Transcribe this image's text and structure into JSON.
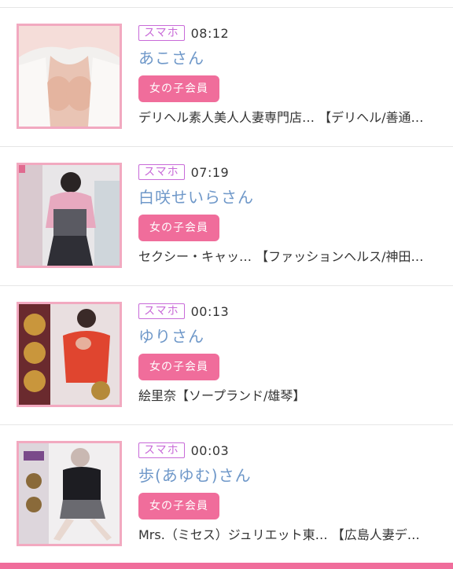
{
  "colors": {
    "device_tag": "#c86ad8",
    "name": "#6f98c9",
    "badge_bg": "#f06d9b",
    "thumb_border": "#f2a9c0",
    "bottom_bar": "#f06d9b"
  },
  "items": [
    {
      "device": "スマホ",
      "time": "08:12",
      "name": "あこさん",
      "badge": "女の子会員",
      "shop": "デリヘル素人美人人妻専門店… 【デリヘル/善通…",
      "thumb_icon": "profile-photo"
    },
    {
      "device": "スマホ",
      "time": "07:19",
      "name": "白咲せいらさん",
      "badge": "女の子会員",
      "shop": "セクシー・キャッ… 【ファッションヘルス/神田…",
      "thumb_icon": "profile-photo"
    },
    {
      "device": "スマホ",
      "time": "00:13",
      "name": "ゆりさん",
      "badge": "女の子会員",
      "shop": "絵里奈【ソープランド/雄琴】",
      "thumb_icon": "profile-photo"
    },
    {
      "device": "スマホ",
      "time": "00:03",
      "name": "歩(あゆむ)さん",
      "badge": "女の子会員",
      "shop": "Mrs.（ミセス）ジュリエット東… 【広島人妻デ…",
      "thumb_icon": "profile-photo"
    }
  ]
}
